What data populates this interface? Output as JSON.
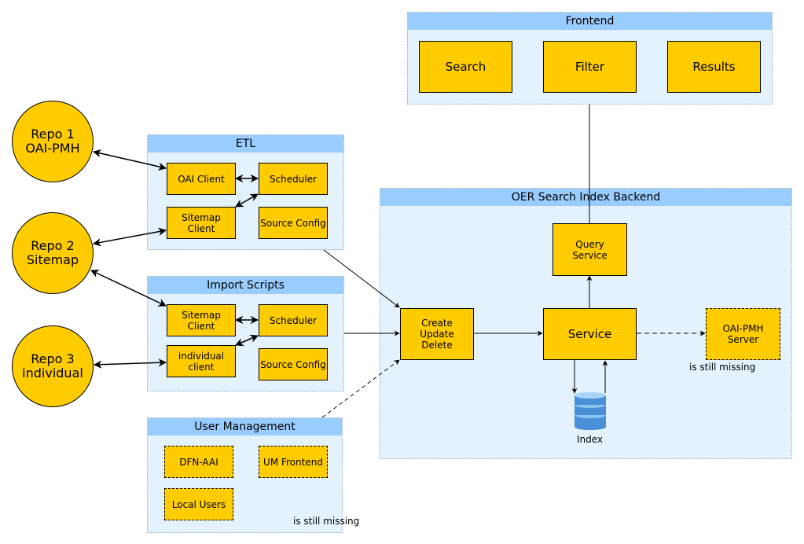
{
  "repos": [
    {
      "line1": "Repo 1",
      "line2": "OAI-PMH"
    },
    {
      "line1": "Repo 2",
      "line2": "Sitemap"
    },
    {
      "line1": "Repo 3",
      "line2": "individual"
    }
  ],
  "frontend": {
    "title": "Frontend",
    "items": [
      "Search",
      "Filter",
      "Results"
    ]
  },
  "etl": {
    "title": "ETL",
    "oai_client": "OAI Client",
    "scheduler": "Scheduler",
    "sitemap_client": "Sitemap Client",
    "source_config": "Source Config"
  },
  "import_scripts": {
    "title": "Import Scripts",
    "sitemap_client": "Sitemap Client",
    "scheduler": "Scheduler",
    "individual_client": "individual client",
    "source_config": "Source Config"
  },
  "user_management": {
    "title": "User Management",
    "dfn_aai": "DFN-AAI",
    "um_frontend": "UM Frontend",
    "local_users": "Local Users",
    "missing_note": "is still missing"
  },
  "backend": {
    "title": "OER Search Index Backend",
    "query_service": "Query Service",
    "cud": "Create Update Delete",
    "service": "Service",
    "oai_pmh_server": "OAI-PMH Server",
    "missing_note": "is still missing",
    "index_label": "Index"
  },
  "colors": {
    "box": "#ffcc00",
    "group_bg": "#e3f2fd",
    "group_header": "#99ccff"
  }
}
